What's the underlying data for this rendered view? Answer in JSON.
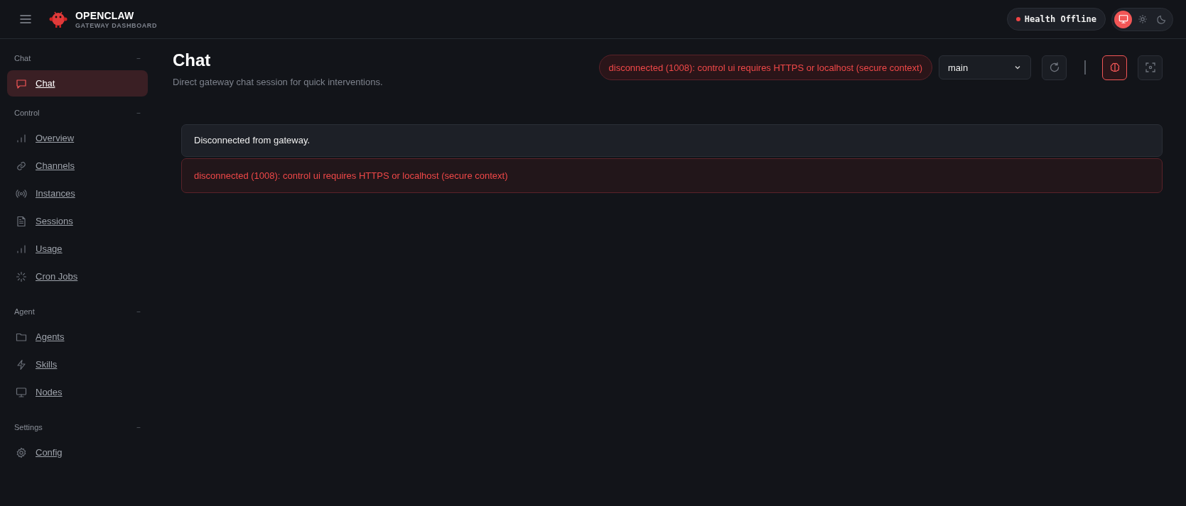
{
  "header": {
    "brand": "OPENCLAW",
    "subtitle": "GATEWAY DASHBOARD",
    "health": {
      "label": "Health",
      "value": "Offline",
      "online": false
    },
    "theme_modes": [
      {
        "kind": "monitor",
        "selected": true
      },
      {
        "kind": "sun",
        "selected": false
      },
      {
        "kind": "moon",
        "selected": false
      }
    ]
  },
  "sidebar": {
    "groups": [
      {
        "title": "Chat",
        "toggle": "−",
        "items": [
          {
            "label": "Chat",
            "kind": "chat",
            "selected": true
          }
        ]
      },
      {
        "title": "Control",
        "toggle": "−",
        "items": [
          {
            "label": "Overview",
            "kind": "bars",
            "selected": false
          },
          {
            "label": "Channels",
            "kind": "link",
            "selected": false
          },
          {
            "label": "Instances",
            "kind": "radio",
            "selected": false
          },
          {
            "label": "Sessions",
            "kind": "file",
            "selected": false
          },
          {
            "label": "Usage",
            "kind": "bars",
            "selected": false
          },
          {
            "label": "Cron Jobs",
            "kind": "loader",
            "selected": false
          }
        ]
      },
      {
        "title": "Agent",
        "toggle": "−",
        "items": [
          {
            "label": "Agents",
            "kind": "folder",
            "selected": false
          },
          {
            "label": "Skills",
            "kind": "bolt",
            "selected": false
          },
          {
            "label": "Nodes",
            "kind": "monitor",
            "selected": false
          }
        ]
      },
      {
        "title": "Settings",
        "toggle": "−",
        "items": [
          {
            "label": "Config",
            "kind": "gear",
            "selected": false
          }
        ]
      }
    ]
  },
  "page": {
    "title": "Chat",
    "subtitle": "Direct gateway chat session for quick interventions.",
    "error_pill": "disconnected (1008): control ui requires HTTPS or localhost (secure context)",
    "session_select": {
      "value": "main"
    },
    "tools": [
      {
        "kind": "refresh",
        "active": false
      },
      {
        "kind": "divider"
      },
      {
        "kind": "brain",
        "active": true
      },
      {
        "kind": "focus",
        "active": false
      }
    ]
  },
  "messages": [
    {
      "kind": "info",
      "text": "Disconnected from gateway."
    },
    {
      "kind": "error",
      "text": "disconnected (1008): control ui requires HTTPS or localhost (secure context)"
    }
  ]
}
